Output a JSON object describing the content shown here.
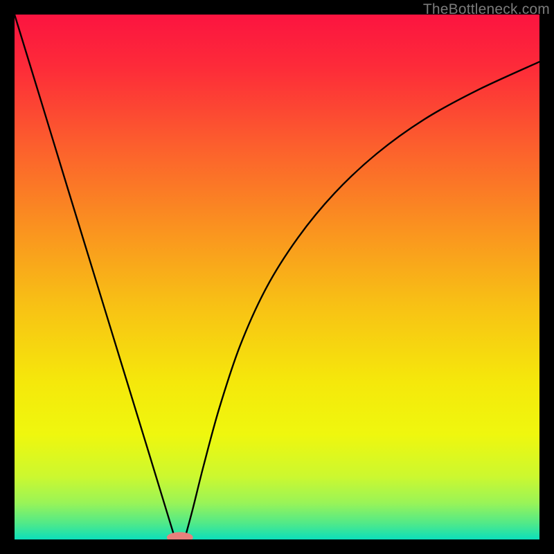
{
  "watermark": "TheBottleneck.com",
  "chart_data": {
    "type": "line",
    "title": "",
    "xlabel": "",
    "ylabel": "",
    "xlim": [
      0,
      1
    ],
    "ylim": [
      0,
      1
    ],
    "gradient_stops": [
      {
        "offset": 0.0,
        "color": "#fc1440"
      },
      {
        "offset": 0.1,
        "color": "#fd2b39"
      },
      {
        "offset": 0.25,
        "color": "#fc5f2d"
      },
      {
        "offset": 0.4,
        "color": "#fa9020"
      },
      {
        "offset": 0.55,
        "color": "#f8c015"
      },
      {
        "offset": 0.7,
        "color": "#f5e80b"
      },
      {
        "offset": 0.8,
        "color": "#eff70e"
      },
      {
        "offset": 0.88,
        "color": "#ccf82f"
      },
      {
        "offset": 0.93,
        "color": "#9af457"
      },
      {
        "offset": 0.97,
        "color": "#4fe98a"
      },
      {
        "offset": 1.0,
        "color": "#0cdfbb"
      }
    ],
    "series": [
      {
        "name": "left-branch",
        "x": [
          0.0,
          0.05,
          0.1,
          0.15,
          0.2,
          0.25,
          0.29,
          0.305
        ],
        "y": [
          1.0,
          0.837,
          0.673,
          0.51,
          0.347,
          0.184,
          0.053,
          0.004
        ]
      },
      {
        "name": "right-branch",
        "x": [
          0.325,
          0.34,
          0.36,
          0.39,
          0.43,
          0.48,
          0.54,
          0.61,
          0.69,
          0.78,
          0.88,
          1.0
        ],
        "y": [
          0.004,
          0.06,
          0.14,
          0.25,
          0.37,
          0.48,
          0.575,
          0.66,
          0.735,
          0.8,
          0.855,
          0.91
        ]
      }
    ],
    "marker": {
      "shape": "capsule",
      "cx": 0.315,
      "cy": 0.004,
      "rx": 0.025,
      "ry": 0.01,
      "color": "#e8807c"
    },
    "curve_stroke": "#000000",
    "curve_width": 2.4
  }
}
